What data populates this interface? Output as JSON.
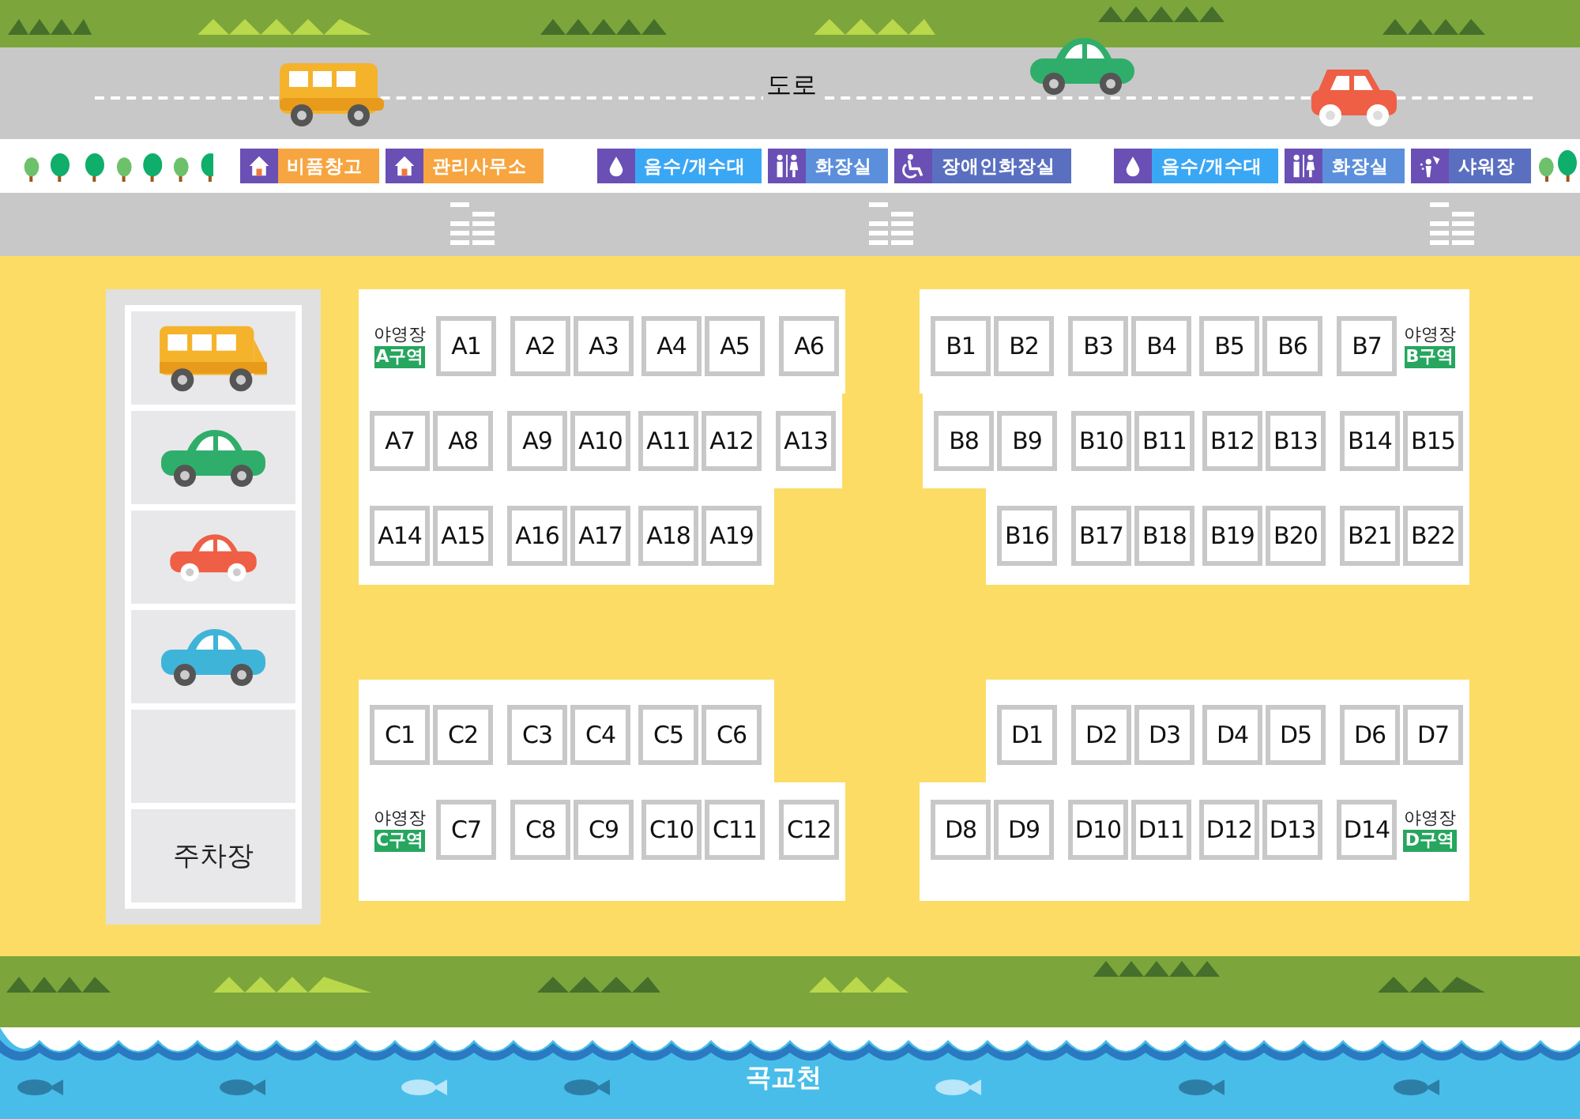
{
  "road": {
    "label": "도로"
  },
  "facility_groups": [
    [
      {
        "kind": "house",
        "label": "비품창고",
        "color": "#f7a540"
      },
      {
        "kind": "house",
        "label": "관리사무소",
        "color": "#f7a540"
      }
    ],
    [
      {
        "kind": "water",
        "label": "음수/개수대",
        "color": "#3aa7f5"
      },
      {
        "kind": "restroom",
        "label": "화장실",
        "color": "#5b8fdc"
      },
      {
        "kind": "accessible",
        "label": "장애인화장실",
        "color": "#5a6fc0"
      }
    ],
    [
      {
        "kind": "water",
        "label": "음수/개수대",
        "color": "#3aa7f5"
      },
      {
        "kind": "restroom",
        "label": "화장실",
        "color": "#5b8fdc"
      },
      {
        "kind": "shower",
        "label": "샤워장",
        "color": "#5a6fc0"
      }
    ]
  ],
  "parking": {
    "label": "주차장"
  },
  "zones": [
    {
      "caption": "야영장",
      "zone": "A구역",
      "rows": [
        [
          {
            "kind": "zone-label"
          },
          {
            "kind": "site",
            "label": "A1"
          },
          {
            "kind": "site",
            "label": "A2"
          },
          {
            "kind": "site",
            "label": "A3"
          },
          {
            "kind": "site",
            "label": "A4"
          },
          {
            "kind": "site",
            "label": "A5"
          },
          {
            "kind": "site",
            "label": "A6"
          }
        ],
        [
          {
            "kind": "site",
            "label": "A7"
          },
          {
            "kind": "site",
            "label": "A8"
          },
          {
            "kind": "site",
            "label": "A9"
          },
          {
            "kind": "site",
            "label": "A10"
          },
          {
            "kind": "site",
            "label": "A11"
          },
          {
            "kind": "site",
            "label": "A12"
          },
          {
            "kind": "site",
            "label": "A13"
          }
        ],
        [
          {
            "kind": "site",
            "label": "A14"
          },
          {
            "kind": "site",
            "label": "A15"
          },
          {
            "kind": "site",
            "label": "A16"
          },
          {
            "kind": "site",
            "label": "A17"
          },
          {
            "kind": "site",
            "label": "A18"
          },
          {
            "kind": "site",
            "label": "A19"
          }
        ]
      ]
    },
    {
      "caption": "야영장",
      "zone": "B구역",
      "rows": [
        [
          {
            "kind": "site",
            "label": "B1"
          },
          {
            "kind": "site",
            "label": "B2"
          },
          {
            "kind": "site",
            "label": "B3"
          },
          {
            "kind": "site",
            "label": "B4"
          },
          {
            "kind": "site",
            "label": "B5"
          },
          {
            "kind": "site",
            "label": "B6"
          },
          {
            "kind": "site",
            "label": "B7"
          },
          {
            "kind": "zone-label"
          }
        ],
        [
          {
            "kind": "site",
            "label": "B8"
          },
          {
            "kind": "site",
            "label": "B9"
          },
          {
            "kind": "site",
            "label": "B10"
          },
          {
            "kind": "site",
            "label": "B11"
          },
          {
            "kind": "site",
            "label": "B12"
          },
          {
            "kind": "site",
            "label": "B13"
          },
          {
            "kind": "site",
            "label": "B14"
          },
          {
            "kind": "site",
            "label": "B15"
          }
        ],
        [
          {
            "kind": "empty"
          },
          {
            "kind": "site",
            "label": "B16"
          },
          {
            "kind": "site",
            "label": "B17"
          },
          {
            "kind": "site",
            "label": "B18"
          },
          {
            "kind": "site",
            "label": "B19"
          },
          {
            "kind": "site",
            "label": "B20"
          },
          {
            "kind": "site",
            "label": "B21"
          },
          {
            "kind": "site",
            "label": "B22"
          }
        ]
      ]
    },
    {
      "caption": "야영장",
      "zone": "C구역",
      "rows": [
        [
          {
            "kind": "site",
            "label": "C1"
          },
          {
            "kind": "site",
            "label": "C2"
          },
          {
            "kind": "site",
            "label": "C3"
          },
          {
            "kind": "site",
            "label": "C4"
          },
          {
            "kind": "site",
            "label": "C5"
          },
          {
            "kind": "site",
            "label": "C6"
          }
        ],
        [
          {
            "kind": "zone-label"
          },
          {
            "kind": "site",
            "label": "C7"
          },
          {
            "kind": "site",
            "label": "C8"
          },
          {
            "kind": "site",
            "label": "C9"
          },
          {
            "kind": "site",
            "label": "C10"
          },
          {
            "kind": "site",
            "label": "C11"
          },
          {
            "kind": "site",
            "label": "C12"
          }
        ]
      ]
    },
    {
      "caption": "야영장",
      "zone": "D구역",
      "rows": [
        [
          {
            "kind": "empty"
          },
          {
            "kind": "site",
            "label": "D1"
          },
          {
            "kind": "site",
            "label": "D2"
          },
          {
            "kind": "site",
            "label": "D3"
          },
          {
            "kind": "site",
            "label": "D4"
          },
          {
            "kind": "site",
            "label": "D5"
          },
          {
            "kind": "site",
            "label": "D6"
          },
          {
            "kind": "site",
            "label": "D7"
          }
        ],
        [
          {
            "kind": "site",
            "label": "D8"
          },
          {
            "kind": "site",
            "label": "D9"
          },
          {
            "kind": "site",
            "label": "D10"
          },
          {
            "kind": "site",
            "label": "D11"
          },
          {
            "kind": "site",
            "label": "D12"
          },
          {
            "kind": "site",
            "label": "D13"
          },
          {
            "kind": "site",
            "label": "D14"
          },
          {
            "kind": "zone-label"
          }
        ]
      ]
    }
  ],
  "river": {
    "label": "곡교천"
  }
}
